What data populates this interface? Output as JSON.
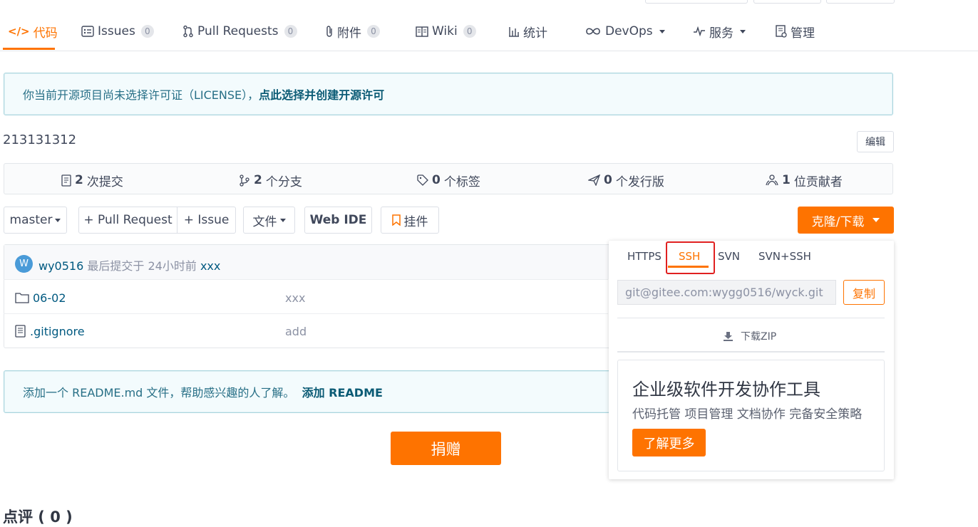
{
  "tabs": [
    {
      "label": "代码",
      "icon": "code-icon"
    },
    {
      "label": "Issues",
      "count": "0",
      "icon": "issues-icon"
    },
    {
      "label": "Pull Requests",
      "count": "0",
      "icon": "pull-request-icon"
    },
    {
      "label": "附件",
      "count": "0",
      "icon": "attachment-icon"
    },
    {
      "label": "Wiki",
      "count": "0",
      "icon": "wiki-icon"
    },
    {
      "label": "统计",
      "icon": "stats-icon"
    },
    {
      "label": "DevOps",
      "icon": "devops-icon"
    },
    {
      "label": "服务",
      "icon": "service-icon"
    },
    {
      "label": "管理",
      "icon": "manage-icon"
    }
  ],
  "license_notice": {
    "text": "你当前开源项目尚未选择许可证（LICENSE），",
    "link": "点此选择并创建开源许可"
  },
  "description": "213131312",
  "edit_label": "编辑",
  "stats": [
    {
      "num": "2",
      "label": "次提交",
      "icon": "commit-icon"
    },
    {
      "num": "2",
      "label": "个分支",
      "icon": "branch-icon"
    },
    {
      "num": "0",
      "label": "个标签",
      "icon": "tag-icon"
    },
    {
      "num": "0",
      "label": "个发行版",
      "icon": "release-icon"
    },
    {
      "num": "1",
      "label": "位贡献者",
      "icon": "contributors-icon"
    }
  ],
  "toolbar": {
    "branch": "master",
    "pull_request": "+ Pull Request",
    "issue": "+ Issue",
    "file": "文件",
    "web_ide": "Web IDE",
    "widget": "挂件",
    "clone": "克隆/下载"
  },
  "commit": {
    "avatar": "W",
    "user": "wy0516",
    "text": "最后提交于",
    "time": "24小时前",
    "message": "xxx"
  },
  "files": [
    {
      "name": "06-02",
      "message": "xxx",
      "type": "folder"
    },
    {
      "name": ".gitignore",
      "message": "add",
      "type": "file"
    }
  ],
  "readme_notice": {
    "text": "添加一个 README.md 文件，帮助感兴趣的人了解。",
    "link": "添加 README"
  },
  "donate": "捐赠",
  "comments_title": "点评 ( 0 )",
  "clone_panel": {
    "tabs": [
      "HTTPS",
      "SSH",
      "SVN",
      "SVN+SSH"
    ],
    "active_tab": "SSH",
    "url": "git@gitee.com:wygg0516/wyck.git",
    "copy": "复制",
    "download_zip": "下载ZIP",
    "promo_title": "企业级软件开发协作工具",
    "promo_desc": "代码托管 项目管理 文档协作 完备安全策略",
    "promo_button": "了解更多"
  },
  "colors": {
    "accent": "#fe7300",
    "link": "#005980",
    "highlight_box": "#e02020"
  }
}
